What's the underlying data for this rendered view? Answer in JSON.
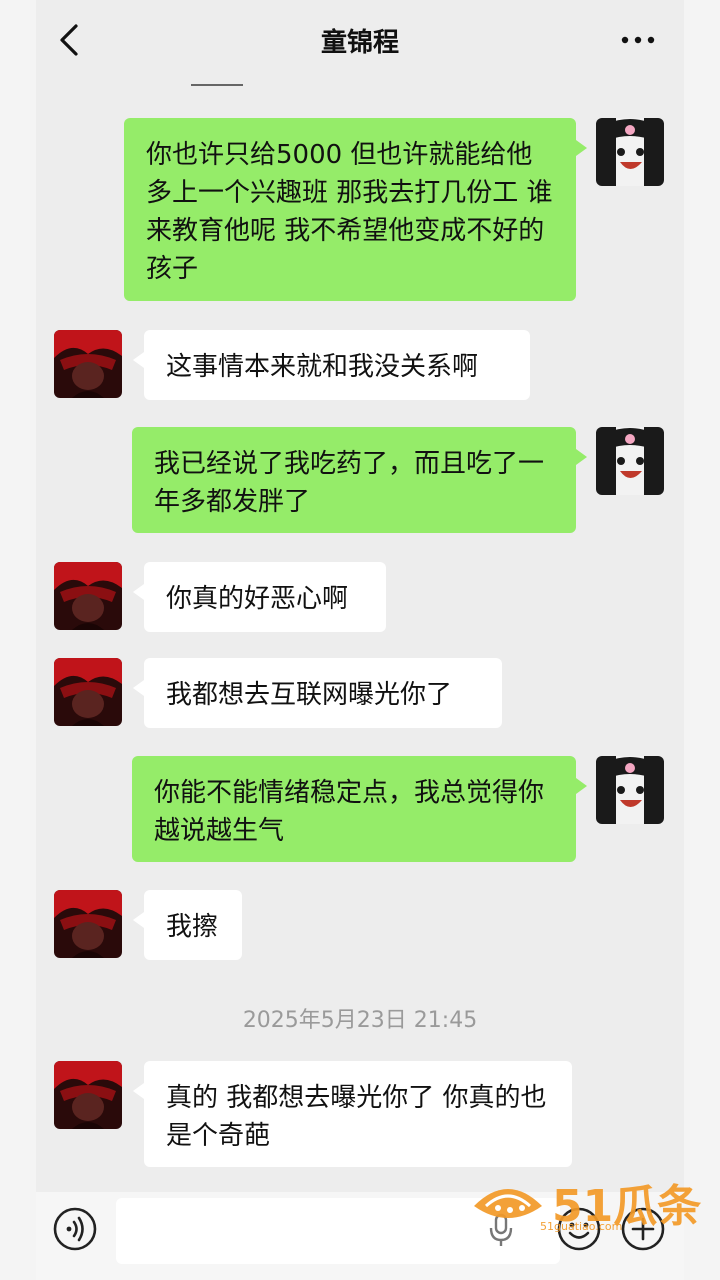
{
  "header": {
    "title": "童锦程"
  },
  "messages": [
    {
      "side": "right",
      "text": "你也许只给5000 但也许就能给他多上一个兴趣班 那我去打几份工 谁来教育他呢 我不希望他变成不好的孩子"
    },
    {
      "side": "left",
      "text": "这事情本来就和我没关系啊"
    },
    {
      "side": "right",
      "text": "我已经说了我吃药了，而且吃了一年多都发胖了"
    },
    {
      "side": "left",
      "text": "你真的好恶心啊"
    },
    {
      "side": "left",
      "text": "我都想去互联网曝光你了"
    },
    {
      "side": "right",
      "text": "你能不能情绪稳定点，我总觉得你越说越生气"
    },
    {
      "side": "left",
      "text": "我擦"
    },
    {
      "side": "left",
      "text": "真的 我都想去曝光你了 你真的也是个奇葩"
    }
  ],
  "timestamp": "2025年5月23日 21:45",
  "input": {
    "placeholder": ""
  },
  "icons": {
    "back": "chevron-left-icon",
    "more": "more-dots-icon",
    "voice": "voice-icon",
    "mic": "microphone-icon",
    "emoji": "emoji-icon",
    "plus": "plus-icon"
  },
  "watermark": {
    "brand": "51瓜条",
    "url": "51guatiao.com"
  },
  "colors": {
    "sent_bubble": "#95ec69",
    "received_bubble": "#ffffff",
    "background": "#ededed",
    "watermark": "#f39a28"
  }
}
